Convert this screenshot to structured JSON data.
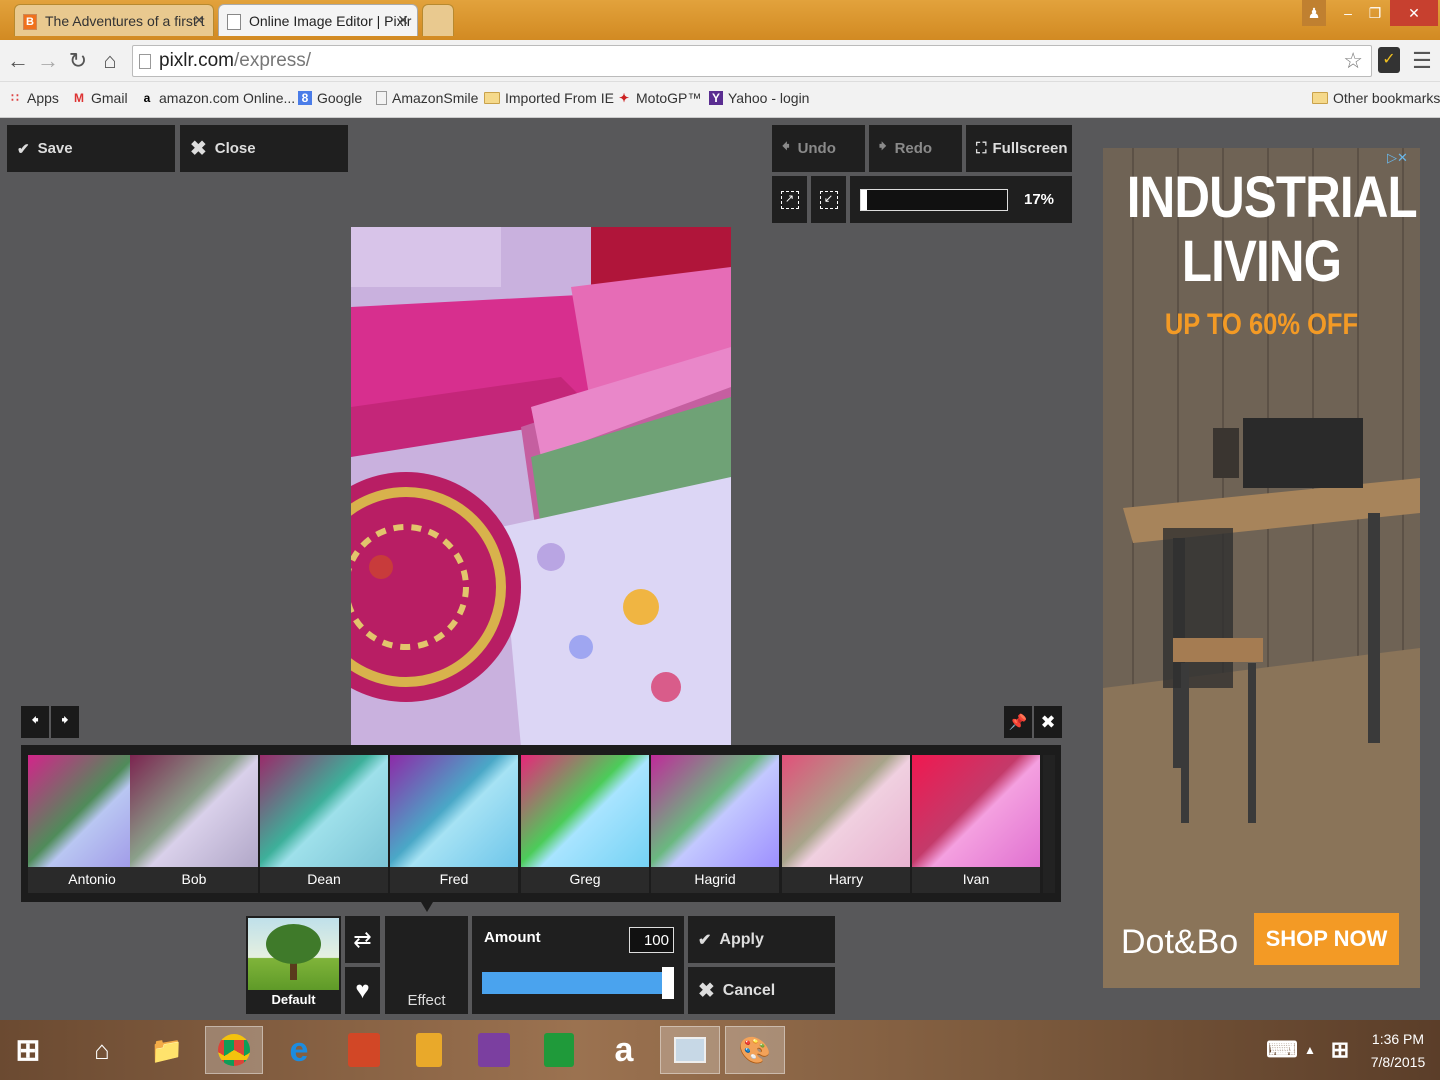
{
  "browser": {
    "tabs": [
      {
        "label": "The Adventures of a first t",
        "favicon": "blogger-icon",
        "active": false
      },
      {
        "label": "Online Image Editor | Pixlr",
        "favicon": "page-icon",
        "active": true
      }
    ],
    "url_domain": "pixlr.com",
    "url_path": "/express/",
    "bookmarks": [
      {
        "label": "Apps",
        "icon": "apps-grid-icon"
      },
      {
        "label": "Gmail",
        "icon": "gmail-icon"
      },
      {
        "label": "amazon.com Online...",
        "icon": "amazon-icon"
      },
      {
        "label": "Google",
        "icon": "google-icon"
      },
      {
        "label": "AmazonSmile",
        "icon": "page-icon"
      },
      {
        "label": "Imported From IE",
        "icon": "folder-icon"
      },
      {
        "label": "MotoGP™",
        "icon": "motogp-icon"
      },
      {
        "label": "Yahoo - login",
        "icon": "yahoo-icon"
      }
    ],
    "other_bookmarks": "Other bookmarks"
  },
  "editor": {
    "save_label": "Save",
    "close_label": "Close",
    "undo_label": "Undo",
    "redo_label": "Redo",
    "fullscreen_label": "Fullscreen",
    "zoom_text": "17%",
    "zoom_fraction": 0.17,
    "filters": [
      "Antonio",
      "Bob",
      "Dean",
      "Fred",
      "Greg",
      "Hagrid",
      "Harry",
      "Ivan"
    ],
    "default_label": "Default",
    "effect_label": "Effect",
    "amount_label": "Amount",
    "amount_value": "100",
    "amount_fraction": 1.0,
    "apply_label": "Apply",
    "cancel_label": "Cancel"
  },
  "ad": {
    "title_line1": "INDUSTRIAL",
    "title_line2": "LIVING",
    "subtitle": "UP TO 60% OFF",
    "brand": "Dot&Bo",
    "cta": "SHOP NOW"
  },
  "taskbar": {
    "time": "1:36 PM",
    "date": "7/8/2015"
  },
  "colors": {
    "accent_orange": "#f39a25",
    "slider_blue": "#4aa3ee",
    "editor_bg": "#58585a",
    "panel_bg": "#1f1f1f"
  }
}
